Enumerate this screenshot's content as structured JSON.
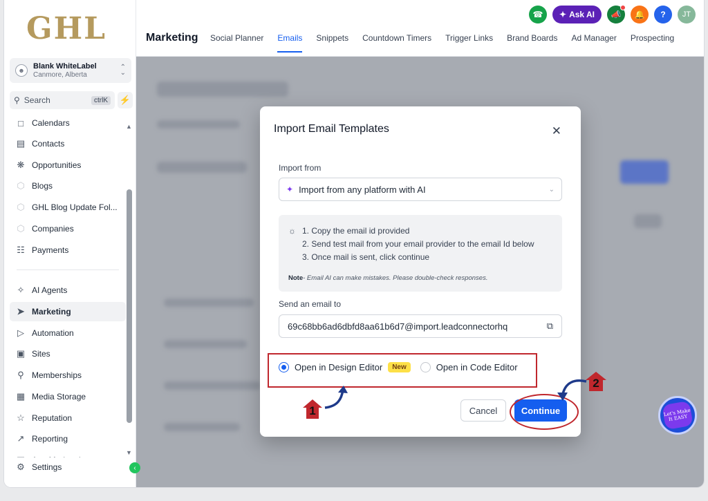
{
  "brand": {
    "logo_text": "GHL"
  },
  "location": {
    "name": "Blank WhiteLabel",
    "subtitle": "Canmore, Alberta"
  },
  "search": {
    "label": "Search",
    "shortcut": "ctrlK"
  },
  "sidebar": {
    "items": [
      {
        "label": "Calendars",
        "icon": "calendar-icon"
      },
      {
        "label": "Contacts",
        "icon": "contacts-icon"
      },
      {
        "label": "Opportunities",
        "icon": "opportunities-icon"
      },
      {
        "label": "Blogs",
        "icon": "blogs-icon"
      },
      {
        "label": "GHL Blog Update Fol...",
        "icon": "folder-icon"
      },
      {
        "label": "Companies",
        "icon": "companies-icon"
      },
      {
        "label": "Payments",
        "icon": "payments-icon"
      },
      {
        "label": "AI Agents",
        "icon": "ai-agents-icon"
      },
      {
        "label": "Marketing",
        "icon": "send-icon"
      },
      {
        "label": "Automation",
        "icon": "automation-icon"
      },
      {
        "label": "Sites",
        "icon": "sites-icon"
      },
      {
        "label": "Memberships",
        "icon": "memberships-icon"
      },
      {
        "label": "Media Storage",
        "icon": "media-icon"
      },
      {
        "label": "Reputation",
        "icon": "star-icon"
      },
      {
        "label": "Reporting",
        "icon": "reporting-icon"
      },
      {
        "label": "App Marketplace",
        "icon": "marketplace-icon"
      },
      {
        "label": "Settings",
        "icon": "gear-icon"
      }
    ],
    "active": "Marketing"
  },
  "header": {
    "ask_ai_label": "Ask AI",
    "help_label": "?",
    "user_initials": "JT",
    "page_title": "Marketing",
    "tabs": [
      "Social Planner",
      "Emails",
      "Snippets",
      "Countdown Timers",
      "Trigger Links",
      "Brand Boards",
      "Ad Manager",
      "Prospecting"
    ],
    "active_tab": "Emails"
  },
  "modal": {
    "title": "Import Email Templates",
    "import_from_label": "Import from",
    "import_from_value": "Import from any platform with AI",
    "steps": [
      "1. Copy the email id provided",
      "2. Send test mail from your email provider to the email Id below",
      "3. Once mail is sent, click continue"
    ],
    "note_label": "Note",
    "note_text": "- Email AI can make mistakes. Please double-check responses.",
    "send_label": "Send an email to",
    "email": "69c68bb6ad6dbfd8aa61b6d7@import.leadconnectorhq",
    "option_design": "Open in Design Editor",
    "option_design_badge": "New",
    "option_code": "Open in Code Editor",
    "selected_option": "design",
    "cancel_label": "Cancel",
    "continue_label": "Continue"
  },
  "annotations": {
    "marker_1": "1",
    "marker_2": "2",
    "badge_text": "Let's Make It EASY"
  },
  "colors": {
    "accent": "#155eef",
    "annotation_red": "#c0272d",
    "arrow_navy": "#1e3a8a",
    "overlay": "#a7abb2"
  }
}
